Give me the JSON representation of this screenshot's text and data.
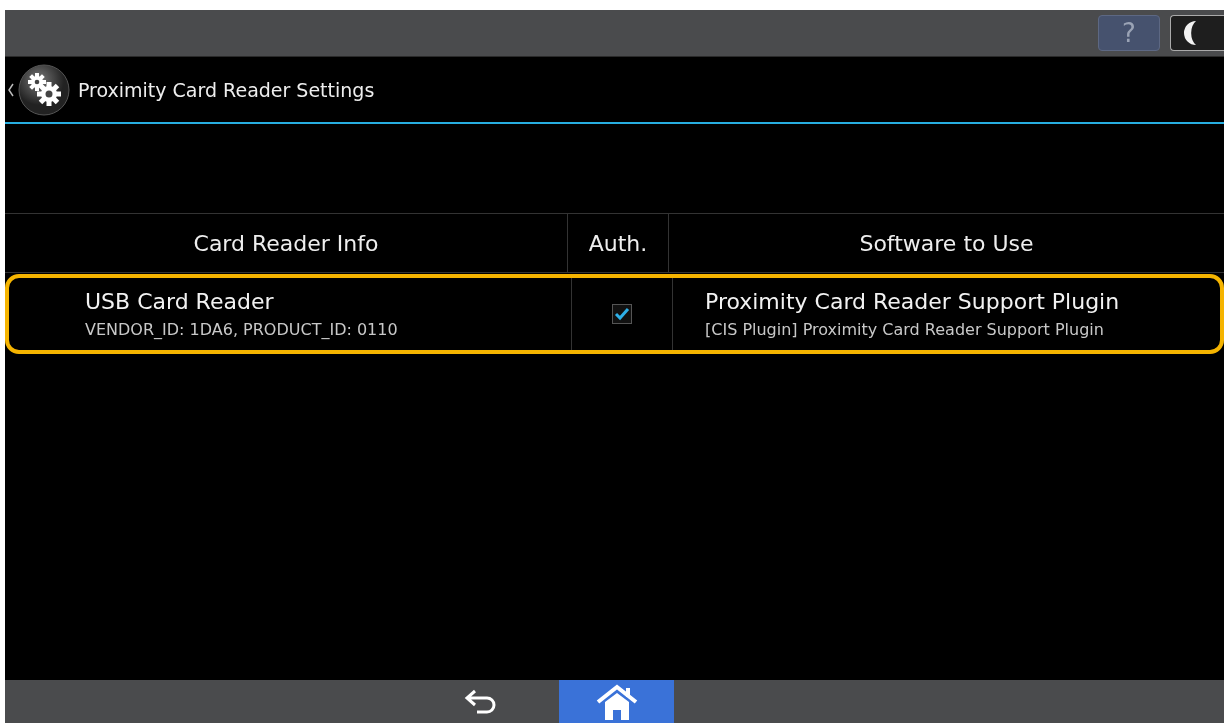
{
  "top_bar": {
    "help_label": "?"
  },
  "header": {
    "title": "Proximity Card Reader Settings"
  },
  "table": {
    "columns": [
      "Card Reader Info",
      "Auth.",
      "Software to Use"
    ],
    "rows": [
      {
        "name": "USB Card Reader",
        "ids": "VENDOR_ID: 1DA6, PRODUCT_ID: 0110",
        "auth_checked": true,
        "software": "Proximity Card Reader Support Plugin",
        "software_detail": "[CIS Plugin] Proximity Card Reader Support Plugin",
        "selected": true
      }
    ]
  },
  "bottom_bar": {
    "home_selected": true
  }
}
